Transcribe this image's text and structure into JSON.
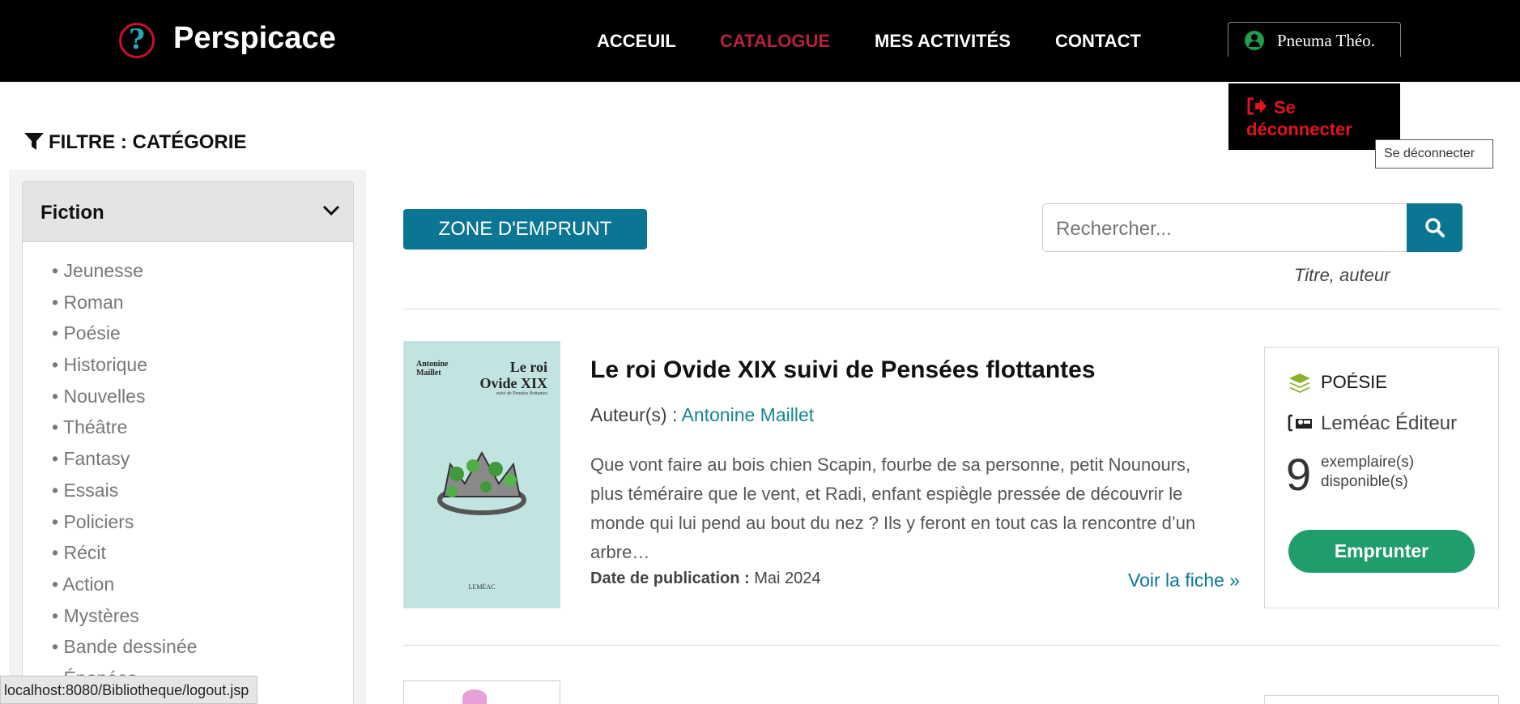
{
  "header": {
    "logo_glyph": "?",
    "brand": "Perspicace",
    "nav": [
      {
        "label": "ACCEUIL",
        "active": false
      },
      {
        "label": "CATALOGUE",
        "active": true
      },
      {
        "label": "MES ACTIVITÉS",
        "active": false
      },
      {
        "label": "CONTACT",
        "active": false
      }
    ],
    "user_name": "Pneuma Théo.",
    "logout_label": "Se déconnecter",
    "tooltip": "Se déconnecter"
  },
  "sidebar": {
    "filter_title": "FILTRE : CATÉGORIE",
    "panel_title": "Fiction",
    "categories": [
      "Jeunesse",
      "Roman",
      "Poésie",
      "Historique",
      "Nouvelles",
      "Théâtre",
      "Fantasy",
      "Essais",
      "Policiers",
      "Récit",
      "Action",
      "Mystères",
      "Bande dessinée",
      "Épopées"
    ]
  },
  "status_bar_url": "localhost:8080/Bibliotheque/logout.jsp",
  "toolbar": {
    "zone_button": "ZONE D'EMPRUNT",
    "search_placeholder": "Rechercher...",
    "search_hint": "Titre, auteur"
  },
  "book": {
    "title": "Le roi Ovide XIX suivi de Pensées flottantes",
    "author_prefix": "Auteur(s) : ",
    "author": "Antonine Maillet",
    "description": "Que vont faire au bois chien Scapin, fourbe de sa personne, petit Nounours, plus téméraire que le vent, et Radi, enfant espiègle pressée de découvrir le monde qui lui pend au bout du nez ? Ils y feront en tout cas la rencontre d’un arbre…",
    "pubdate_label": "Date de publication :",
    "pubdate": "Mai 2024",
    "view_link": "Voir la fiche »",
    "genre": "POÉSIE",
    "publisher": "Leméac Éditeur",
    "copies": "9",
    "copies_label_1": "exemplaire(s)",
    "copies_label_2": "disponible(s)",
    "borrow_button": "Emprunter",
    "cover": {
      "author_line1": "Antonine",
      "author_line2": "Maillet",
      "title_line1": "Le roi",
      "title_line2": "Ovide XIX",
      "subtitle": "suivi de Pensées flottantes",
      "publisher": "LEMÉAC"
    }
  },
  "colors": {
    "accent": "#0a7693",
    "nav_active": "#b5223c",
    "logout": "#e3141d",
    "borrow": "#1f9d6a",
    "author_link": "#15878c"
  }
}
